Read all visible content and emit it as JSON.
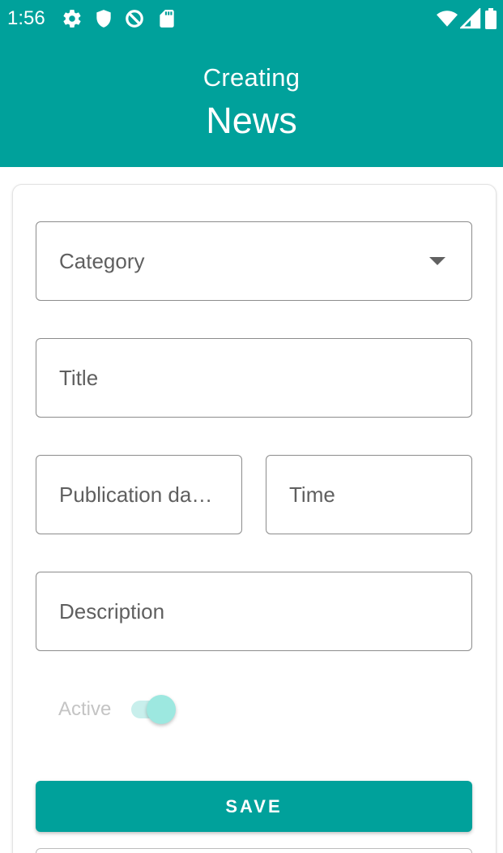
{
  "status_bar": {
    "time": "1:56",
    "left_icons": [
      "gear-icon",
      "shield-icon",
      "data-saver-icon",
      "sd-card-icon"
    ],
    "right_icons": [
      "wifi-icon",
      "cellular-signal-icon",
      "battery-icon"
    ]
  },
  "header": {
    "subtitle": "Creating",
    "title": "News"
  },
  "form": {
    "category_label": "Category",
    "title_label": "Title",
    "publication_date_label": "Publication da…",
    "time_label": "Time",
    "description_label": "Description",
    "active_label": "Active",
    "active_on": true,
    "save_label": "SAVE"
  },
  "colors": {
    "primary": "#00a19b",
    "switch_thumb": "#9de8e0",
    "switch_track": "#c8efec"
  }
}
